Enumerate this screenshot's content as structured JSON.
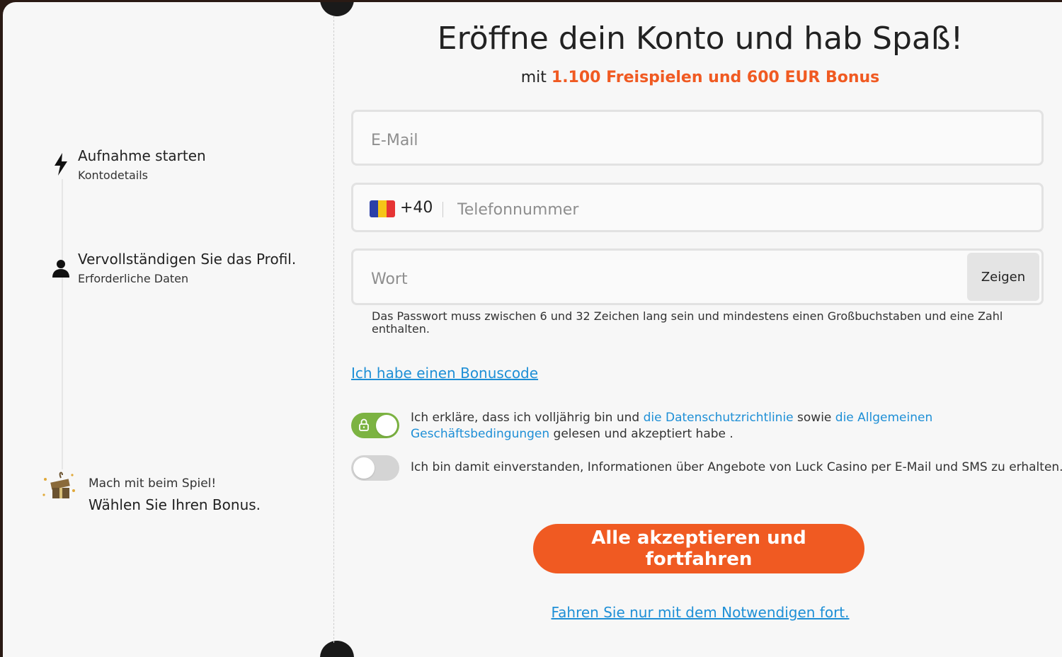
{
  "sidebar": {
    "steps": [
      {
        "icon": "bolt-icon",
        "title": "Aufnahme starten",
        "subtitle": "Kontodetails"
      },
      {
        "icon": "user-icon",
        "title": "Vervollständigen Sie das Profil.",
        "subtitle": "Erforderliche Daten"
      },
      {
        "icon": "gift-icon",
        "title": "Mach mit beim Spiel!",
        "subtitle": "Wählen Sie Ihren Bonus."
      }
    ]
  },
  "header": {
    "title": "Eröffne dein Konto und hab Spaß!",
    "subtitle_prefix": "mit",
    "subtitle_highlight": "1.100 Freispielen und 600 EUR Bonus"
  },
  "form": {
    "email": {
      "placeholder": "E-Mail",
      "value": ""
    },
    "phone": {
      "prefix": "+40",
      "placeholder": "Telefonnummer",
      "value": "",
      "flag": "Romania"
    },
    "password": {
      "placeholder": "Wort",
      "value": "",
      "show_label": "Zeigen"
    },
    "password_hint": "Das Passwort muss zwischen 6 und 32 Zeichen lang sein und mindestens einen Großbuchstaben und eine Zahl enthalten.",
    "bonus_code_link": "Ich habe einen Bonuscode"
  },
  "consents": [
    {
      "checked": true,
      "text_1": "Ich erkläre, dass ich volljährig bin und",
      "link_1": "die Datenschutzrichtlinie",
      "text_2": "sowie",
      "link_2": "die Allgemeinen Geschäftsbedingungen",
      "text_3": "gelesen und akzeptiert habe ."
    },
    {
      "checked": false,
      "text": "Ich bin damit einverstanden, Informationen über Angebote von Luck Casino per E-Mail und SMS zu erhalten."
    }
  ],
  "actions": {
    "accept_all": "Alle akzeptieren und fortfahren",
    "necessary_only": "Fahren Sie nur mit dem Notwendigen fort."
  },
  "colors": {
    "accent": "#f05a22",
    "link": "#1e8fd6",
    "toggle_on": "#7cb342",
    "toggle_off": "#d4d4d4"
  }
}
